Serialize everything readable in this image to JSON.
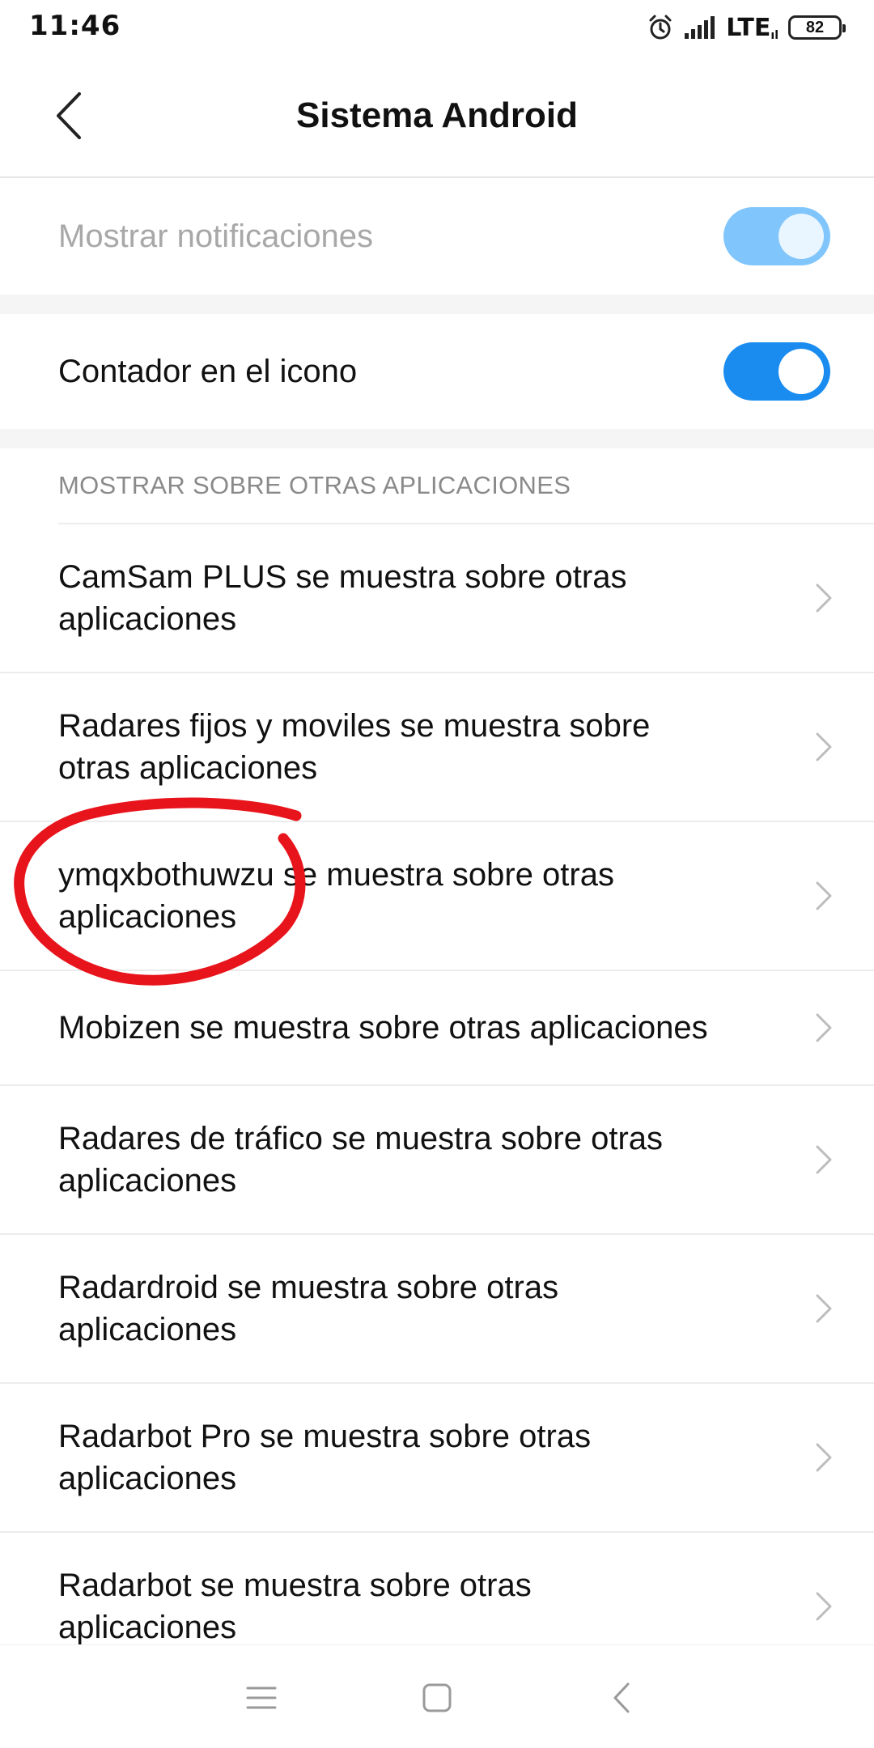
{
  "status_bar": {
    "time": "11:46",
    "network": "LTE",
    "network_sub": "ıl",
    "battery": "82",
    "icons": [
      "alarm-icon",
      "signal-icon",
      "battery-icon"
    ]
  },
  "header": {
    "title": "Sistema Android",
    "back_icon": "chevron-left-icon"
  },
  "toggles": [
    {
      "label": "Mostrar notificaciones",
      "on": true,
      "enabled": false
    },
    {
      "label": "Contador en el icono",
      "on": true,
      "enabled": true
    }
  ],
  "section": {
    "title": "MOSTRAR SOBRE OTRAS APLICACIONES",
    "items": [
      {
        "line1": "CamSam PLUS se muestra sobre otras",
        "line2": "aplicaciones"
      },
      {
        "line1": "Radares fijos y moviles se muestra sobre",
        "line2": "otras aplicaciones"
      },
      {
        "line1": "ymqxbothuwzu se muestra sobre otras",
        "line2": "aplicaciones"
      },
      {
        "line1": "Mobizen se muestra sobre otras aplicaciones"
      },
      {
        "line1": "Radares de tráfico se muestra sobre otras",
        "line2": "aplicaciones"
      },
      {
        "line1": "Radardroid se muestra sobre otras",
        "line2": "aplicaciones"
      },
      {
        "line1": "Radarbot Pro se muestra sobre otras",
        "line2": "aplicaciones"
      },
      {
        "line1": "Radarbot se muestra sobre otras",
        "line2": "aplicaciones"
      }
    ]
  },
  "annotation": {
    "color": "#e8141c",
    "target_item": 2
  },
  "colors": {
    "accent": "#1a8cf0",
    "accent_disabled": "#80c5fb",
    "section_gray": "#8a8a8a"
  },
  "nav_bar": {
    "icons": [
      "menu-icon",
      "home-square-icon",
      "back-triangle-icon"
    ]
  }
}
